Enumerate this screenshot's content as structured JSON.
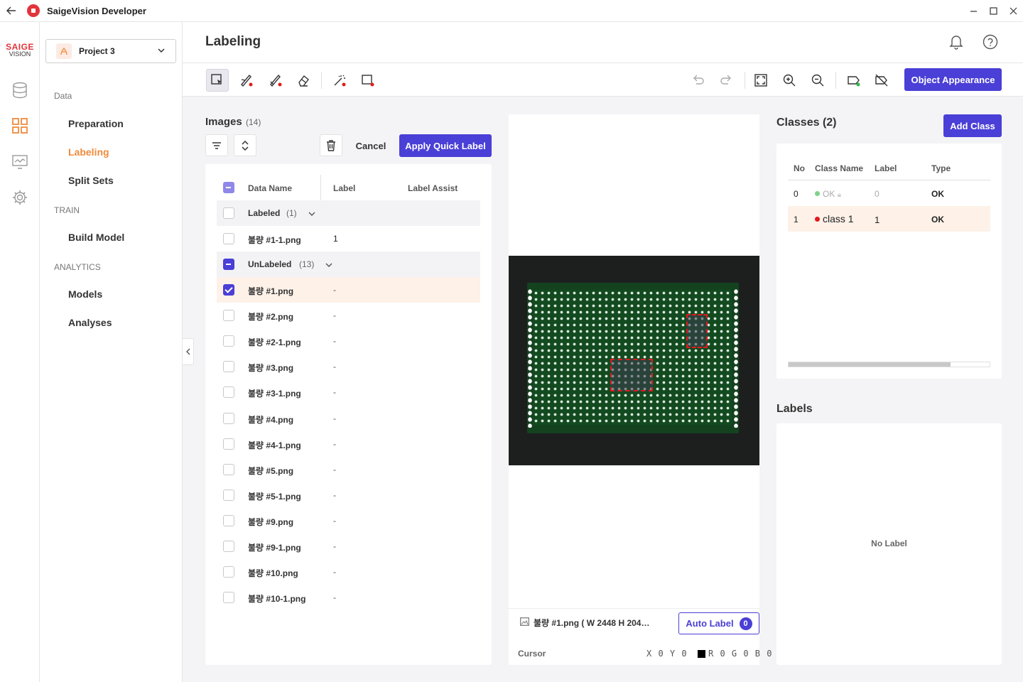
{
  "app": {
    "title": "SaigeVision Developer"
  },
  "brand": {
    "line1": "SAIGE",
    "line2": "VISION"
  },
  "sidebar": {
    "project": "Project 3",
    "sections": [
      {
        "label": "Data",
        "items": [
          "Preparation",
          "Labeling",
          "Split Sets"
        ]
      },
      {
        "label": "TRAIN",
        "items": [
          "Build Model"
        ]
      },
      {
        "label": "ANALYTICS",
        "items": [
          "Models",
          "Analyses"
        ]
      }
    ],
    "active_item": "Labeling"
  },
  "header": {
    "title": "Labeling"
  },
  "toolbar": {
    "object_appearance": "Object Appearance"
  },
  "images": {
    "title": "Images",
    "count": "(14)",
    "cancel": "Cancel",
    "apply_quick_label": "Apply Quick Label",
    "columns": {
      "name": "Data Name",
      "label": "Label",
      "assist": "Label Assist"
    },
    "groups": {
      "labeled": {
        "name": "Labeled",
        "count": "(1)"
      },
      "unlabeled": {
        "name": "UnLabeled",
        "count": "(13)"
      }
    },
    "labeled_rows": [
      {
        "name": "불량 #1-1.png",
        "label": "1"
      }
    ],
    "unlabeled_rows": [
      {
        "name": "불량 #1.png",
        "label": "-"
      },
      {
        "name": "불량 #2.png",
        "label": "-"
      },
      {
        "name": "불량 #2-1.png",
        "label": "-"
      },
      {
        "name": "불량 #3.png",
        "label": "-"
      },
      {
        "name": "불량 #3-1.png",
        "label": "-"
      },
      {
        "name": "불량 #4.png",
        "label": "-"
      },
      {
        "name": "불량 #4-1.png",
        "label": "-"
      },
      {
        "name": "불량 #5.png",
        "label": "-"
      },
      {
        "name": "불량 #5-1.png",
        "label": "-"
      },
      {
        "name": "불량 #9.png",
        "label": "-"
      },
      {
        "name": "불량 #9-1.png",
        "label": "-"
      },
      {
        "name": "불량 #10.png",
        "label": "-"
      },
      {
        "name": "불량 #10-1.png",
        "label": "-"
      }
    ]
  },
  "canvas": {
    "file_info": "불량 #1.png ( W 2448 H 204…",
    "auto_label": "Auto Label",
    "auto_label_count": "0",
    "cursor_label": "Cursor",
    "cursor_xy": "X 0 Y 0",
    "cursor_rgb": "R 0 G 0 B 0"
  },
  "classes": {
    "title": "Classes (2)",
    "add_class": "Add Class",
    "columns": {
      "no": "No",
      "name": "Class Name",
      "label": "Label",
      "type": "Type"
    },
    "rows": [
      {
        "no": "0",
        "name": "OK",
        "label": "0",
        "type": "OK",
        "color": "#7ed28c"
      },
      {
        "no": "1",
        "name": "class 1",
        "label": "1",
        "type": "OK",
        "color": "#e01b1b"
      }
    ]
  },
  "labels": {
    "title": "Labels",
    "empty": "No Label"
  },
  "colors": {
    "accent": "#4a3fd6",
    "brand": "#e1353b",
    "active_nav": "#f08a3c"
  }
}
